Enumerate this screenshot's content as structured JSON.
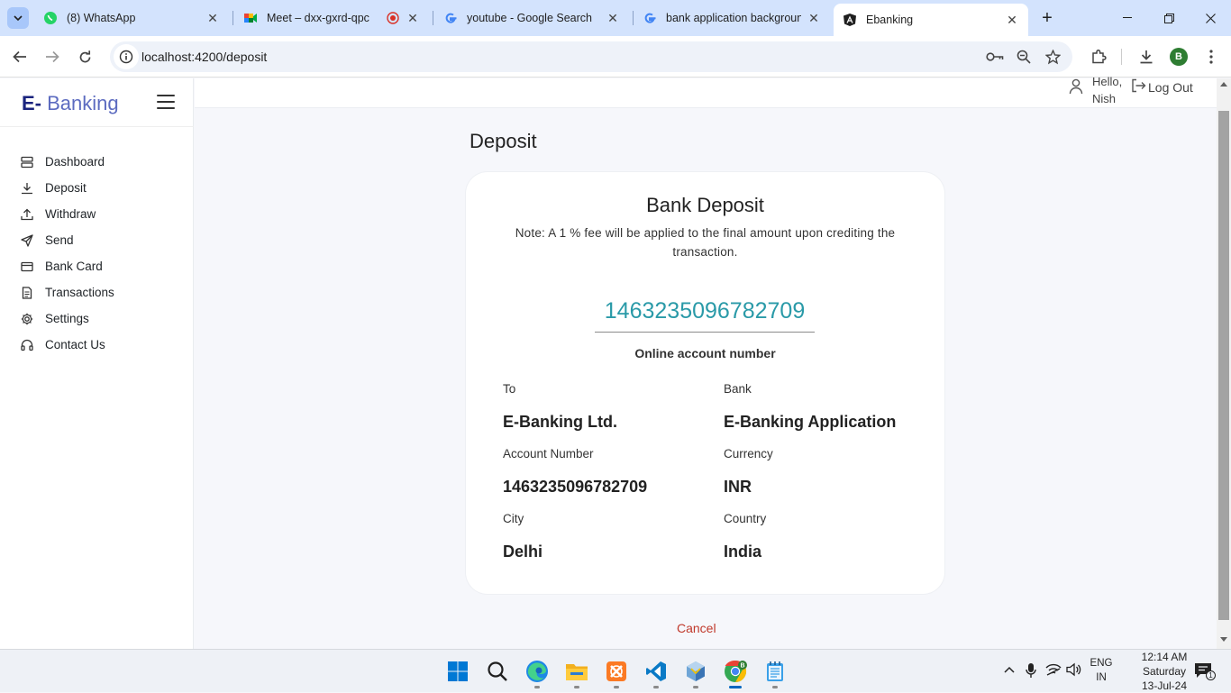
{
  "browser": {
    "tabs": [
      {
        "title": "(8) WhatsApp",
        "icon": "whatsapp-icon"
      },
      {
        "title": "Meet – dxx-gxrd-qpc",
        "icon": "google-meet-icon"
      },
      {
        "title": "youtube - Google Search",
        "icon": "google-icon"
      },
      {
        "title": "bank application backgroun",
        "icon": "google-icon"
      },
      {
        "title": "Ebanking",
        "icon": "angular-icon"
      }
    ],
    "url": "localhost:4200/deposit",
    "profile_initial": "B"
  },
  "app": {
    "brand": {
      "prefix": "E-",
      "name": "Banking"
    },
    "nav": [
      {
        "label": "Dashboard",
        "icon": "dashboard-icon"
      },
      {
        "label": "Deposit",
        "icon": "download-icon"
      },
      {
        "label": "Withdraw",
        "icon": "upload-icon"
      },
      {
        "label": "Send",
        "icon": "send-icon"
      },
      {
        "label": "Bank Card",
        "icon": "credit-card-icon"
      },
      {
        "label": "Transactions",
        "icon": "document-icon"
      },
      {
        "label": "Settings",
        "icon": "gear-icon"
      },
      {
        "label": "Contact Us",
        "icon": "headset-icon"
      }
    ],
    "user": {
      "greeting": "Hello,",
      "name": "Nish"
    },
    "logout_label": "Log Out"
  },
  "deposit": {
    "page_title": "Deposit",
    "card_title": "Bank Deposit",
    "note": "Note: A 1 % fee will be applied to the final amount upon crediting the transaction.",
    "account_number_display": "1463235096782709",
    "account_caption": "Online account number",
    "fields": {
      "to": {
        "label": "To",
        "value": "E-Banking Ltd."
      },
      "bank": {
        "label": "Bank",
        "value": "E-Banking Application"
      },
      "account_number": {
        "label": "Account Number",
        "value": "1463235096782709"
      },
      "currency": {
        "label": "Currency",
        "value": "INR"
      },
      "city": {
        "label": "City",
        "value": "Delhi"
      },
      "country": {
        "label": "Country",
        "value": "India"
      }
    },
    "cancel_label": "Cancel"
  },
  "taskbar": {
    "apps": [
      "windows-start-icon",
      "search-icon",
      "edge-icon",
      "file-explorer-icon",
      "xampp-icon",
      "vscode-icon",
      "virtualbox-icon",
      "chrome-icon",
      "notepad-icon"
    ],
    "lang_line1": "ENG",
    "lang_line2": "IN",
    "time": "12:14 AM",
    "day": "Saturday",
    "date": "13-Jul-24",
    "notification_count": "1"
  }
}
